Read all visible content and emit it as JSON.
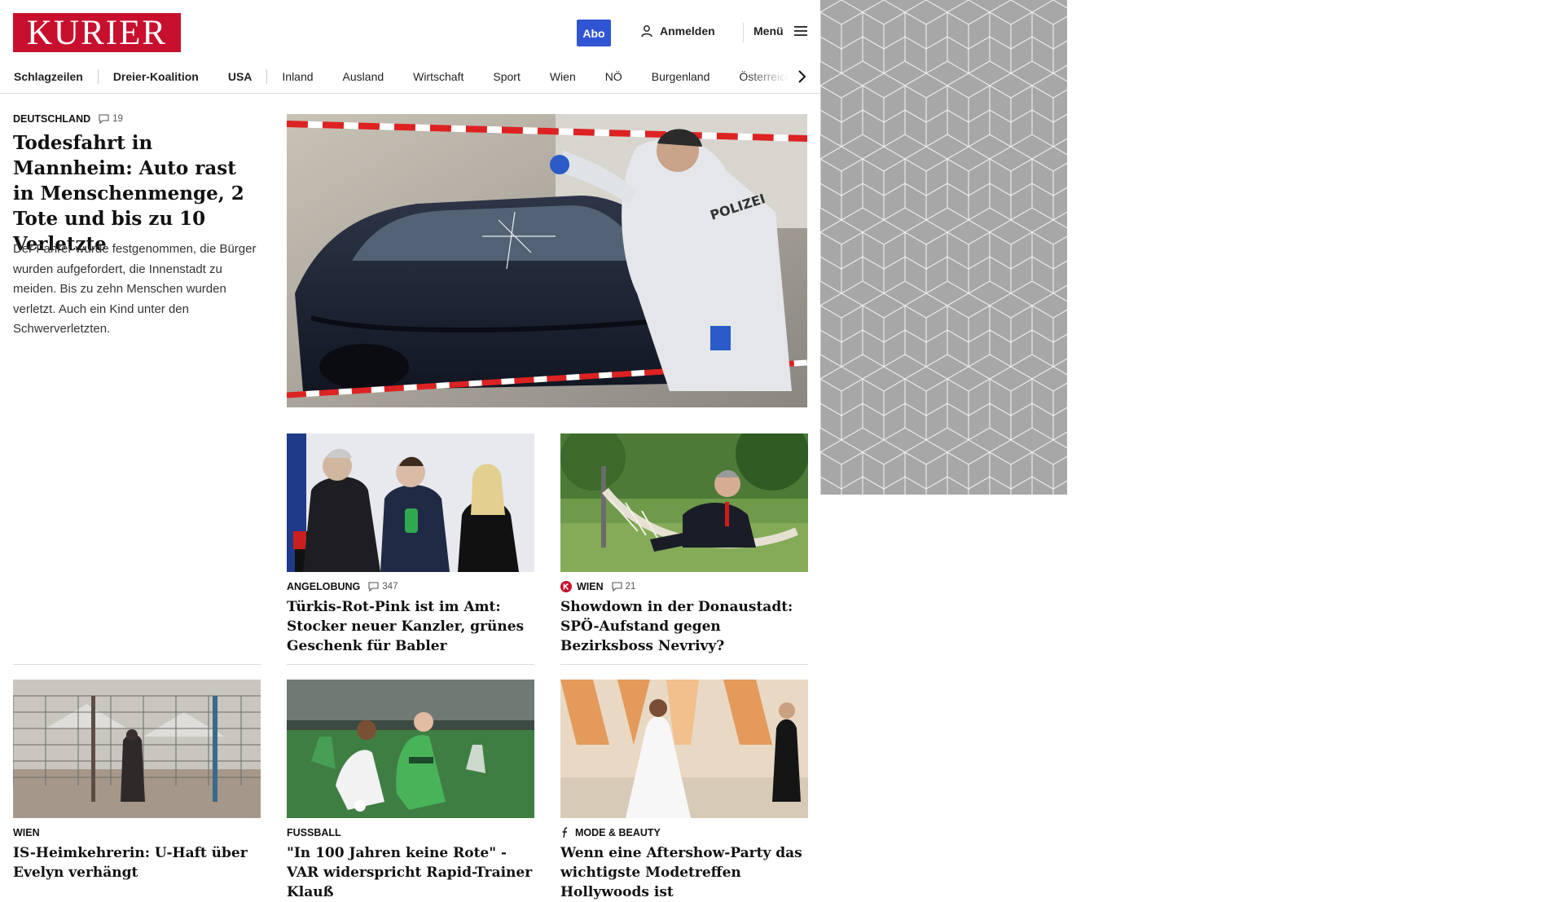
{
  "header": {
    "logo": "KURIER",
    "subscribe_label": "Abo",
    "login_label": "Anmelden",
    "menu_label": "Menü"
  },
  "nav": {
    "items": [
      {
        "label": "Schlagzeilen"
      },
      {
        "label": "Dreier-Koalition"
      },
      {
        "label": "USA"
      },
      {
        "label": "Inland"
      },
      {
        "label": "Ausland"
      },
      {
        "label": "Wirtschaft"
      },
      {
        "label": "Sport"
      },
      {
        "label": "Wien"
      },
      {
        "label": "NÖ"
      },
      {
        "label": "Burgenland"
      },
      {
        "label": "Österreich"
      }
    ]
  },
  "lead": {
    "kicker": "DEUTSCHLAND",
    "comments": "19",
    "title": "Todesfahrt in Mannheim: Auto rast in Menschenmenge, 2 Tote und bis zu 10 Verletzte",
    "teaser": "Der Fahrer wurde festgenommen, die Bürger wurden aufgefordert, die Innenstadt zu meiden. Bis zu zehn Menschen wurden verletzt. Auch ein Kind unter den Schwerverletzten.",
    "image_text": "POLIZEI"
  },
  "cards": [
    {
      "kicker": "ANGELOBUNG",
      "comments": "347",
      "title": "Türkis-Rot-Pink ist im Amt: Stocker neuer Kanzler, grünes Geschenk für Babler"
    },
    {
      "kicker": "WIEN",
      "comments": "21",
      "title": "Showdown in der Donaustadt: SPÖ-Aufstand gegen Bezirksboss Nevrivy?"
    },
    {
      "kicker": "WIEN",
      "title": "IS-Heimkehrerin: U-Haft über Evelyn verhängt"
    },
    {
      "kicker": "FUSSBALL",
      "title": "\"In 100 Jahren keine Rote\" - VAR widerspricht Rapid-Trainer Klauß"
    },
    {
      "kicker": "MODE & BEAUTY",
      "title": "Wenn eine Aftershow-Party das wichtigste Modetreffen Hollywoods ist"
    }
  ],
  "colors": {
    "brand_red": "#c8102e",
    "abo_blue": "#2f55d4",
    "side_pattern_grey": "#a7a7a7"
  }
}
